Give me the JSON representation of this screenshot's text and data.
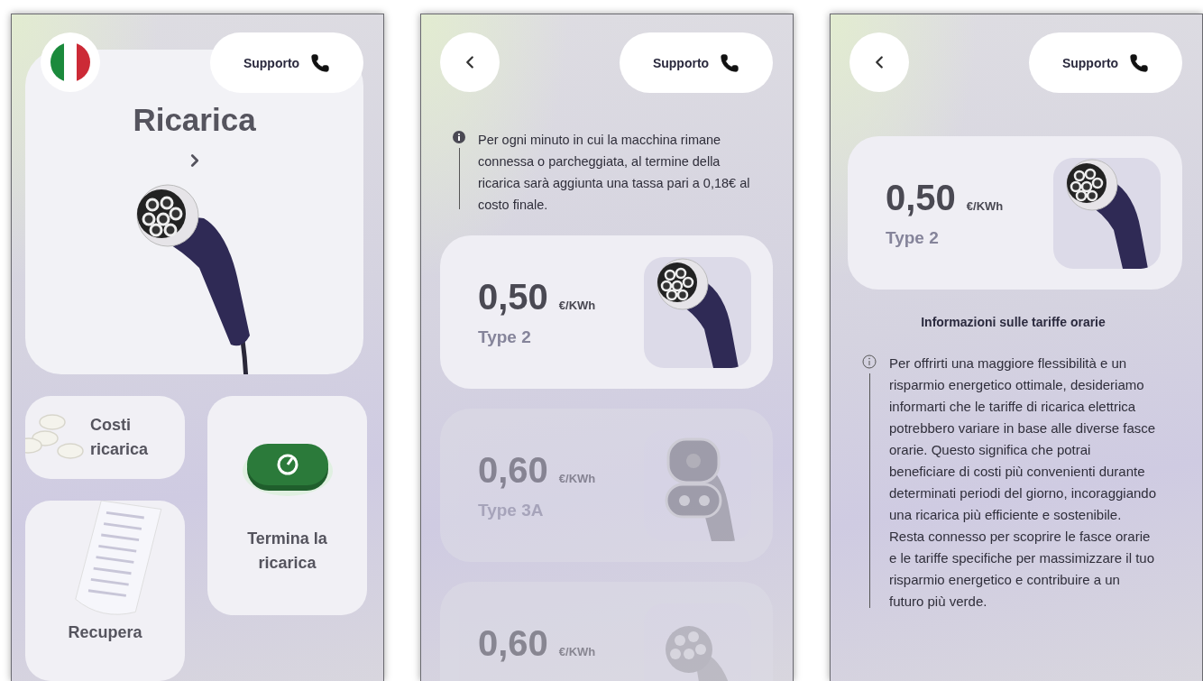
{
  "home_screen": {
    "flag": {
      "kind": "italy"
    },
    "support_label": "Supporto",
    "hero": {
      "title": "Ricarica"
    },
    "tiles": [
      {
        "kind": "coins",
        "label": "Costi ricarica"
      },
      {
        "kind": "power",
        "label": "Termina la ricarica"
      },
      {
        "kind": "receipt",
        "label": "Recupera"
      }
    ]
  },
  "tariff_list_screen": {
    "support_label": "Supporto",
    "notice": {
      "kind": "filled",
      "text": "Per ogni minuto in cui la macchina rimane connessa o parcheggiata, al termine della ricarica sarà aggiunta una tassa pari a 0,18€ al costo finale."
    },
    "tariffs": [
      {
        "price": "0,50",
        "unit": "€/KWh",
        "type": "Type 2",
        "kind": "type2",
        "available": true
      },
      {
        "price": "0,60",
        "unit": "€/KWh",
        "type": "Type 3A",
        "kind": "type3a",
        "available": false
      },
      {
        "price": "0,60",
        "unit": "€/KWh",
        "kind": "ccs",
        "available": false
      }
    ]
  },
  "tariff_detail_screen": {
    "support_label": "Supporto",
    "tariff": {
      "price": "0,50",
      "unit": "€/KWh",
      "type": "Type 2",
      "kind": "type2",
      "available": true
    },
    "heading": "Informazioni sulle tariffe orarie",
    "notice": {
      "kind": "outline",
      "text": "Per offrirti una maggiore flessibilità e un risparmio energetico ottimale, desideriamo informarti che le tariffe di ricarica elettrica potrebbero variare in base alle diverse fasce orarie. Questo significa che potrai beneficiare di costi più convenienti durante determinati periodi del giorno, incoraggiando una ricarica più efficiente e sostenibile. Resta connesso per scoprire le fasce orarie e le tariffe specifiche per massimizzare il tuo risparmio energetico e contribuire a un futuro più verde."
    }
  }
}
